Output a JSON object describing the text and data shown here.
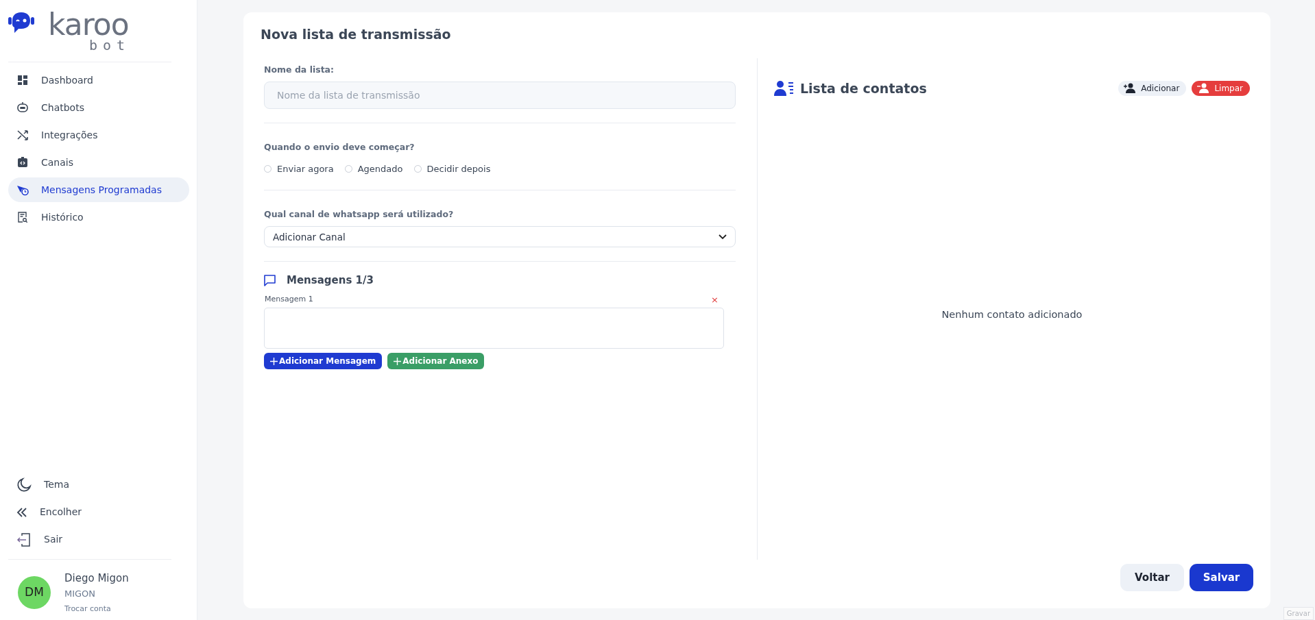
{
  "brand": {
    "name": "karoo",
    "sub": "bot"
  },
  "sidebar": {
    "items": [
      {
        "label": "Dashboard",
        "selected": false
      },
      {
        "label": "Chatbots",
        "selected": false
      },
      {
        "label": "Integrações",
        "selected": false
      },
      {
        "label": "Canais",
        "selected": false
      },
      {
        "label": "Mensagens Programadas",
        "selected": true
      },
      {
        "label": "Histórico",
        "selected": false
      }
    ],
    "footer_items": [
      {
        "label": "Tema"
      },
      {
        "label": "Encolher"
      },
      {
        "label": "Sair"
      }
    ],
    "user": {
      "initials": "DM",
      "name": "Diego Migon",
      "account": "MIGON",
      "switch_link": "Trocar conta"
    }
  },
  "form": {
    "title": "Nova lista de transmissão",
    "name_field": {
      "label": "Nome da lista:",
      "placeholder": "Nome da lista de transmissão"
    },
    "start": {
      "label": "Quando o envio deve começar?",
      "options": [
        {
          "label": "Enviar agora",
          "selected": false
        },
        {
          "label": "Agendado",
          "selected": false
        },
        {
          "label": "Decidir depois",
          "selected": false
        }
      ]
    },
    "channel": {
      "label": "Qual canal de whatsapp será utilizado?",
      "value": "Adicionar Canal"
    },
    "messages": {
      "title": "Mensagens 1/3",
      "items": [
        {
          "label": "Mensagem 1",
          "remove": "×"
        }
      ]
    },
    "buttons": [
      {
        "label": "Adicionar Mensagem",
        "kind": "primary"
      },
      {
        "label": "Adicionar Anexo",
        "kind": "success"
      }
    ]
  },
  "contacts": {
    "title": "Lista de contatos",
    "actions": [
      {
        "label": "Adicionar",
        "kind": "light"
      },
      {
        "label": "Limpar",
        "kind": "danger"
      }
    ],
    "empty": "Nenhum contato adicionado"
  },
  "footer_buttons": [
    {
      "label": "Voltar",
      "kind": "light"
    },
    {
      "label": "Salvar",
      "kind": "primary"
    }
  ],
  "record_button": "Gravar"
}
